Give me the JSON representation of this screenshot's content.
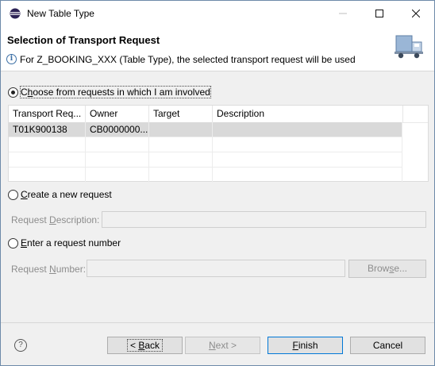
{
  "window": {
    "title": "New Table Type"
  },
  "header": {
    "title": "Selection of Transport Request",
    "message": "For Z_BOOKING_XXX (Table Type), the selected transport request will be used"
  },
  "options": {
    "choose": {
      "label_mnemonic": "h",
      "label_pre": "C",
      "label_post": "oose from requests in which I am involved",
      "selected": true
    },
    "create": {
      "label_mnemonic": "C",
      "label_post": "reate a new request",
      "selected": false
    },
    "enter": {
      "label_mnemonic": "E",
      "label_post": "nter a request number",
      "selected": false
    }
  },
  "table": {
    "columns": [
      "Transport Req...",
      "Owner",
      "Target",
      "Description"
    ],
    "rows": [
      {
        "transport_request": "T01K900138",
        "owner": "CB0000000...",
        "target": "",
        "description": ""
      }
    ]
  },
  "fields": {
    "request_description": {
      "label_pre": "Request ",
      "label_mnemonic": "D",
      "label_post": "escription:",
      "value": ""
    },
    "request_number": {
      "label_pre": "Request ",
      "label_mnemonic": "N",
      "label_post": "umber:",
      "value": ""
    },
    "browse_pre": "Brow",
    "browse_mnemonic": "s",
    "browse_post": "e..."
  },
  "buttons": {
    "back_pre": "< ",
    "back_mnemonic": "B",
    "back_post": "ack",
    "next_mnemonic": "N",
    "next_post": "ext >",
    "finish_mnemonic": "F",
    "finish_post": "inish",
    "cancel": "Cancel",
    "help_glyph": "?"
  },
  "colors": {
    "accent": "#0078d7",
    "selection": "#d9d9d9"
  }
}
